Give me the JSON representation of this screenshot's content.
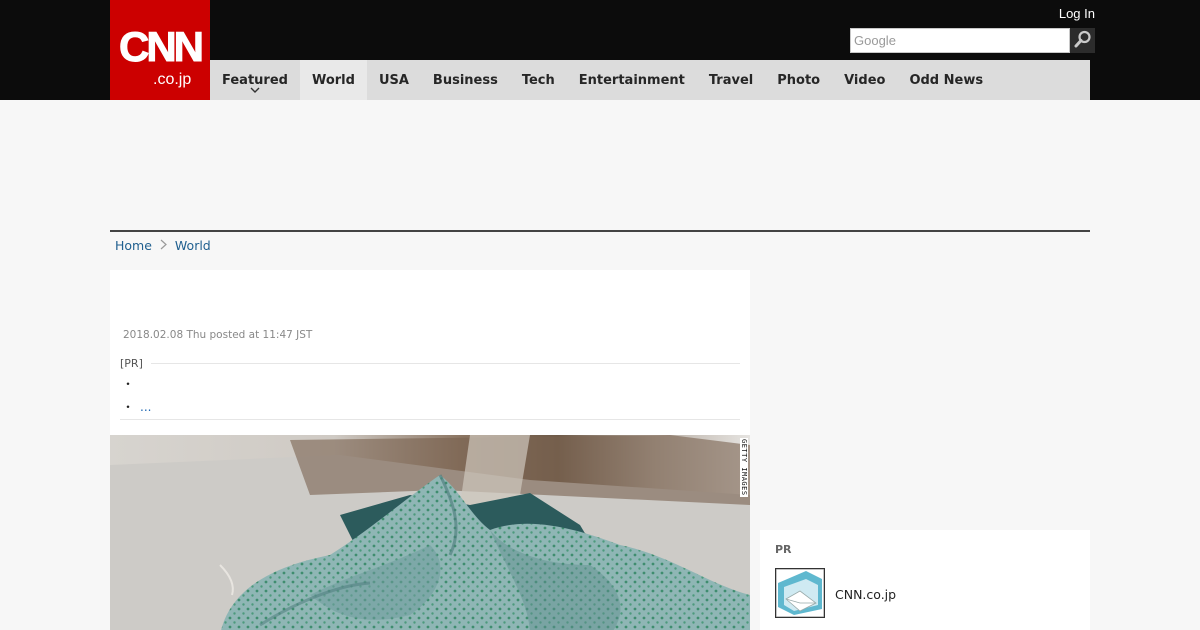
{
  "header": {
    "logo_primary": "CNN",
    "logo_secondary": ".co.jp",
    "login_label": "Log In",
    "search_placeholder": "Google",
    "brand_color": "#cc0000"
  },
  "nav": {
    "items": [
      {
        "label": "Featured",
        "has_dropdown": true
      },
      {
        "label": "World",
        "active": true
      },
      {
        "label": "USA"
      },
      {
        "label": "Business"
      },
      {
        "label": "Tech"
      },
      {
        "label": "Entertainment"
      },
      {
        "label": "Travel"
      },
      {
        "label": "Photo"
      },
      {
        "label": "Video"
      },
      {
        "label": "Odd News"
      }
    ]
  },
  "breadcrumb": {
    "home": "Home",
    "separator": ">",
    "current": "World"
  },
  "article": {
    "dateline": "2018.02.08 Thu posted at 11:47 JST",
    "pr_label": "[PR]",
    "pr_items": [
      {
        "bullet": "・",
        "text": ""
      },
      {
        "bullet": "・",
        "text": "..."
      }
    ],
    "photo_credit": "GETTY IMAGES"
  },
  "sidebar_pr": {
    "title": "PR",
    "item_label": "CNN.co.jp"
  }
}
